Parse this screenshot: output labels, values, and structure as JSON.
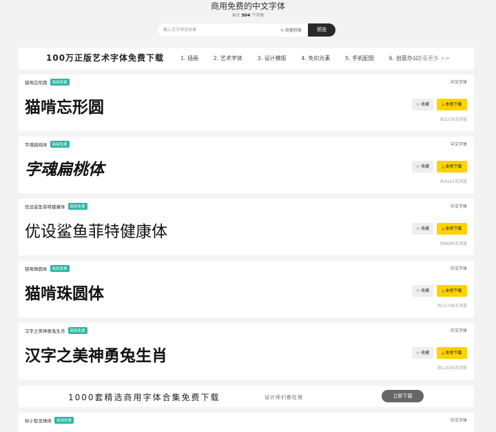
{
  "header": {
    "title": "商用免费的中文字体",
    "count_prefix": "共计",
    "count_value": "504",
    "count_suffix": "个字体"
  },
  "search": {
    "placeholder": "输入文字预览效果",
    "simplified_toggle": "简繁转换",
    "preview_button": "预览"
  },
  "top_banner": {
    "promo": "100万正版艺术字体免费下载",
    "nav": [
      "1. 插画",
      "2. 艺术字体",
      "3. 设计模版",
      "4. 免扣元素",
      "5. 手机配图",
      "6. 创意办公"
    ],
    "more": "查看更多 >>"
  },
  "fonts": [
    {
      "name": "猫啃忘形圆",
      "badge": "商用免费",
      "category": "中文字体",
      "sample": "猫啃忘形圆",
      "fav": "收藏",
      "download": "本地下载",
      "views": "共2278次浏览"
    },
    {
      "name": "字魂扁桃体",
      "badge": "商用免费",
      "category": "中文字体",
      "sample": "字魂扁桃体",
      "fav": "收藏",
      "download": "本地下载",
      "views": "共4163次浏览"
    },
    {
      "name": "优设鲨鱼菲特健康体",
      "badge": "商用免费",
      "category": "中文字体",
      "sample": "优设鲨鱼菲特健康体",
      "fav": "收藏",
      "download": "本地下载",
      "views": "共9699次浏览"
    },
    {
      "name": "猫啃珠圆体",
      "badge": "商用免费",
      "category": "中文字体",
      "sample": "猫啃珠圆体",
      "fav": "收藏",
      "download": "本地下载",
      "views": "共13748次浏览"
    },
    {
      "name": "汉字之美神勇兔生肖",
      "badge": "商用免费",
      "category": "中文字体",
      "sample": "汉字之美神勇兔生肖",
      "fav": "收藏",
      "download": "本地下载",
      "views": "共12509次浏览"
    }
  ],
  "bottom_banner": {
    "promo": "1000套精选商用字体合集免费下载",
    "sub": "设计师们都在用",
    "button": "立即下载"
  },
  "partial_font": {
    "name": "标小智龙珠体",
    "badge": "商用免费",
    "category": "中文字体"
  }
}
